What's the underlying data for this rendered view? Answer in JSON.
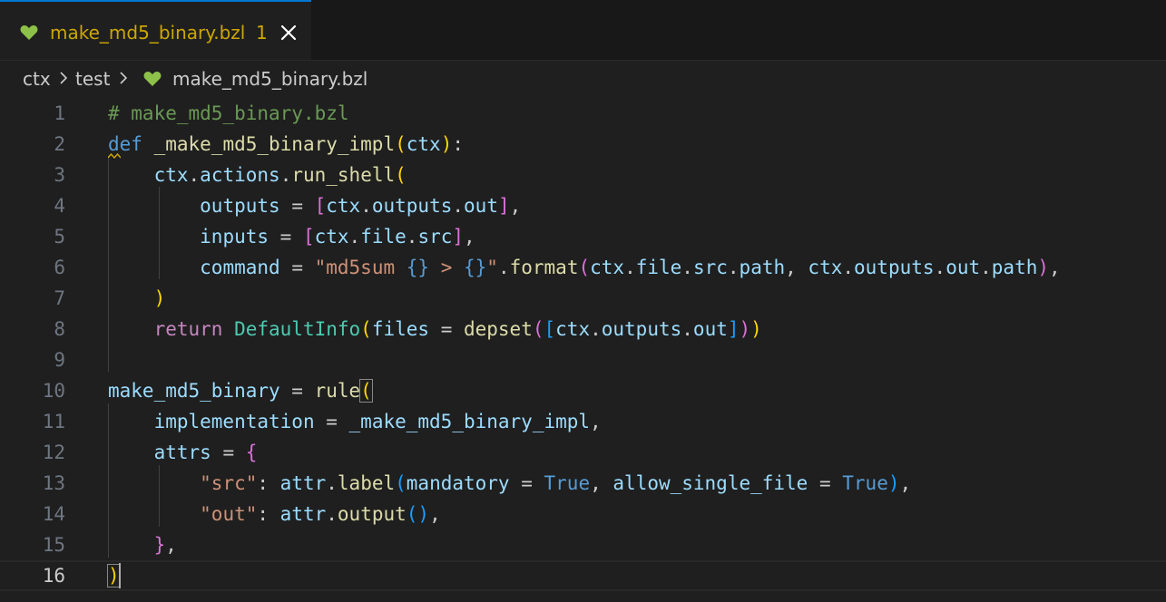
{
  "tab": {
    "label": "make_md5_binary.bzl",
    "badge": "1",
    "icon": "heart-icon",
    "icon_color": "#8dc149",
    "active_border_color": "#0078d4",
    "label_color": "#cca700"
  },
  "breadcrumb": {
    "items": [
      "ctx",
      "test",
      "make_md5_binary.bzl"
    ]
  },
  "editor": {
    "current_line": 16,
    "line_numbers": [
      "1",
      "2",
      "3",
      "4",
      "5",
      "6",
      "7",
      "8",
      "9",
      "10",
      "11",
      "12",
      "13",
      "14",
      "15",
      "16"
    ]
  }
}
